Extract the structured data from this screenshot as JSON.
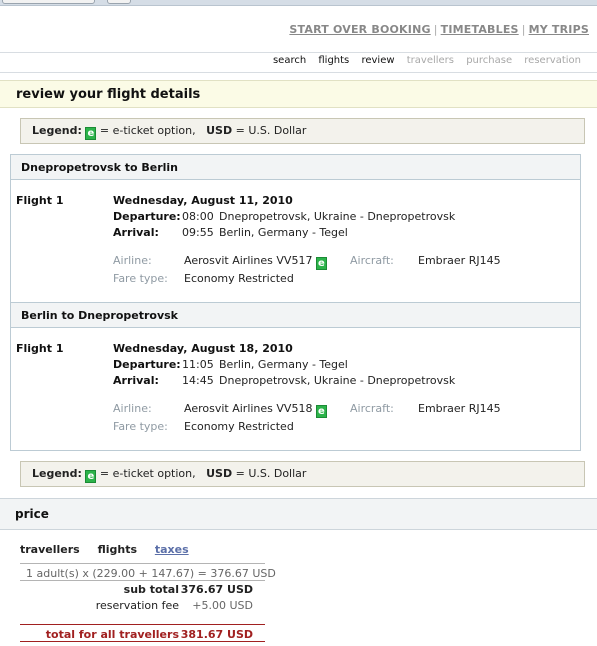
{
  "top_links": [
    "START OVER BOOKING",
    "TIMETABLES",
    "MY TRIPS"
  ],
  "steps": [
    {
      "label": "search",
      "active": true
    },
    {
      "label": "flights",
      "active": true
    },
    {
      "label": "review",
      "active": true
    },
    {
      "label": "travellers",
      "active": false
    },
    {
      "label": "purchase",
      "active": false
    },
    {
      "label": "reservation",
      "active": false
    }
  ],
  "page_title": "review your flight details",
  "legend": {
    "label": "Legend:",
    "badge": "e",
    "eticket_text": "= e-ticket option,",
    "currency_code": "USD",
    "currency_text": "= U.S. Dollar"
  },
  "trips": [
    {
      "route": "Dnepropetrovsk to Berlin",
      "flight_label": "Flight 1",
      "date": "Wednesday, August 11, 2010",
      "departure_label": "Departure:",
      "departure_time": "08:00",
      "departure_place": "Dnepropetrovsk, Ukraine - Dnepropetrovsk",
      "arrival_label": "Arrival:",
      "arrival_time": "09:55",
      "arrival_place": "Berlin, Germany - Tegel",
      "airline_label": "Airline:",
      "airline": "Aerosvit Airlines VV517",
      "aircraft_label": "Aircraft:",
      "aircraft": "Embraer RJ145",
      "fare_label": "Fare type:",
      "fare": "Economy Restricted"
    },
    {
      "route": "Berlin to Dnepropetrovsk",
      "flight_label": "Flight 1",
      "date": "Wednesday, August 18, 2010",
      "departure_label": "Departure:",
      "departure_time": "11:05",
      "departure_place": "Berlin, Germany - Tegel",
      "arrival_label": "Arrival:",
      "arrival_time": "14:45",
      "arrival_place": "Dnepropetrovsk, Ukraine - Dnepropetrovsk",
      "airline_label": "Airline:",
      "airline": "Aerosvit Airlines VV518",
      "aircraft_label": "Aircraft:",
      "aircraft": "Embraer RJ145",
      "fare_label": "Fare type:",
      "fare": "Economy Restricted"
    }
  ],
  "price": {
    "title": "price",
    "tabs": {
      "travellers": "travellers",
      "flights": "flights",
      "taxes": "taxes"
    },
    "calc_line": "1 adult(s) x (229.00 + 147.67) = 376.67 USD",
    "subtotal_label": "sub total",
    "subtotal_value": "376.67 USD",
    "fee_label": "reservation fee",
    "fee_value": "+5.00 USD",
    "total_label": "total for all travellers",
    "total_value": "381.67 USD"
  },
  "colors": {
    "eticket_badge": "#2cb34a",
    "total_text": "#a12020",
    "link": "#5b6fa8"
  }
}
